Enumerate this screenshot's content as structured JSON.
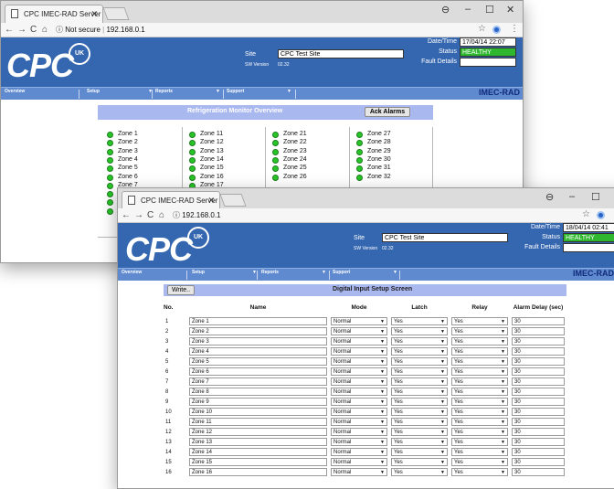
{
  "back_window": {
    "tab_title": "CPC IMEC-RAD Server",
    "url_security": "Not secure",
    "url": "192.168.0.1",
    "site_label": "Site",
    "site_value": "CPC Test Site",
    "sw_label": "SW Version",
    "sw_value": "02.32",
    "date_label": "Date/Time",
    "date_value": "17/04/14 22:07",
    "status_label": "Status",
    "status_value": "HEALTHY",
    "fault_label": "Fault Details",
    "fault_value": "",
    "menu": [
      "Overview",
      "Setup",
      "Reports",
      "Support"
    ],
    "brand": "IMEC-RAD",
    "section_title": "Refrigeration Monitor Overview",
    "ack_button": "Ack Alarms",
    "zones_col1": [
      "Zone 1",
      "Zone 2",
      "Zone 3",
      "Zone 4",
      "Zone 5",
      "Zone 6",
      "Zone 7"
    ],
    "zones_col2": [
      "Zone 11",
      "Zone 12",
      "Zone 13",
      "Zone 14",
      "Zone 15",
      "Zone 16",
      "Zone 17"
    ],
    "zones_col3": [
      "Zone 21",
      "Zone 22",
      "Zone 23",
      "Zone 24",
      "Zone 25",
      "Zone 26"
    ],
    "zones_col4": [
      "Zone 27",
      "Zone 28",
      "Zone 29",
      "Zone 30",
      "Zone 31",
      "Zone 32"
    ]
  },
  "front_window": {
    "tab_title": "CPC IMEC-RAD Server",
    "url": "192.168.0.1",
    "site_label": "Site",
    "site_value": "CPC Test Site",
    "sw_label": "SW Version",
    "sw_value": "02.32",
    "date_label": "Date/Time",
    "date_value": "18/04/14 02:41",
    "status_label": "Status",
    "status_value": "HEALTHY",
    "fault_label": "Fault Details",
    "fault_value": "",
    "menu": [
      "Overview",
      "Setup",
      "Reports",
      "Support"
    ],
    "brand": "IMEC-RAD",
    "write_button": "Write..",
    "section_title": "Digital Input Setup Screen",
    "columns": [
      "No.",
      "Name",
      "Mode",
      "Latch",
      "Relay",
      "Alarm Delay (sec)"
    ],
    "rows": [
      {
        "no": "1",
        "name": "Zone 1",
        "mode": "Normal",
        "latch": "Yes",
        "relay": "Yes",
        "delay": "30"
      },
      {
        "no": "2",
        "name": "Zone 2",
        "mode": "Normal",
        "latch": "Yes",
        "relay": "Yes",
        "delay": "30"
      },
      {
        "no": "3",
        "name": "Zone 3",
        "mode": "Normal",
        "latch": "Yes",
        "relay": "Yes",
        "delay": "30"
      },
      {
        "no": "4",
        "name": "Zone 4",
        "mode": "Normal",
        "latch": "Yes",
        "relay": "Yes",
        "delay": "30"
      },
      {
        "no": "5",
        "name": "Zone 5",
        "mode": "Normal",
        "latch": "Yes",
        "relay": "Yes",
        "delay": "30"
      },
      {
        "no": "6",
        "name": "Zone 6",
        "mode": "Normal",
        "latch": "Yes",
        "relay": "Yes",
        "delay": "30"
      },
      {
        "no": "7",
        "name": "Zone 7",
        "mode": "Normal",
        "latch": "Yes",
        "relay": "Yes",
        "delay": "30"
      },
      {
        "no": "8",
        "name": "Zone 8",
        "mode": "Normal",
        "latch": "Yes",
        "relay": "Yes",
        "delay": "30"
      },
      {
        "no": "9",
        "name": "Zone 9",
        "mode": "Normal",
        "latch": "Yes",
        "relay": "Yes",
        "delay": "30"
      },
      {
        "no": "10",
        "name": "Zone 10",
        "mode": "Normal",
        "latch": "Yes",
        "relay": "Yes",
        "delay": "30"
      },
      {
        "no": "11",
        "name": "Zone 11",
        "mode": "Normal",
        "latch": "Yes",
        "relay": "Yes",
        "delay": "30"
      },
      {
        "no": "12",
        "name": "Zone 12",
        "mode": "Normal",
        "latch": "Yes",
        "relay": "Yes",
        "delay": "30"
      },
      {
        "no": "13",
        "name": "Zone 13",
        "mode": "Normal",
        "latch": "Yes",
        "relay": "Yes",
        "delay": "30"
      },
      {
        "no": "14",
        "name": "Zone 14",
        "mode": "Normal",
        "latch": "Yes",
        "relay": "Yes",
        "delay": "30"
      },
      {
        "no": "15",
        "name": "Zone 15",
        "mode": "Normal",
        "latch": "Yes",
        "relay": "Yes",
        "delay": "30"
      },
      {
        "no": "16",
        "name": "Zone 16",
        "mode": "Normal",
        "latch": "Yes",
        "relay": "Yes",
        "delay": "30"
      }
    ]
  }
}
